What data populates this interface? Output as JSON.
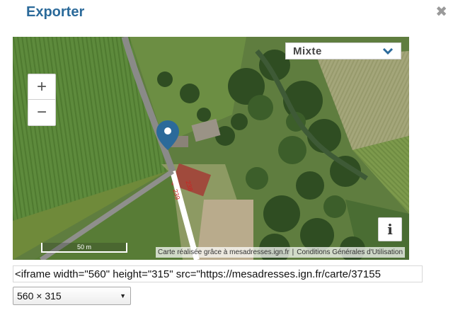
{
  "dialog": {
    "title": "Exporter",
    "close_icon": "close-icon",
    "close_glyph": "✖"
  },
  "map": {
    "zoom_in": "+",
    "zoom_out": "−",
    "layer_selected": "Mixte",
    "info_label": "i",
    "scale_label": "50 m",
    "road_labels": [
      "239",
      "238"
    ],
    "attribution": {
      "credit": "Carte réalisée grâce à mesadresses.ign.fr",
      "separator": "|",
      "terms": "Conditions Générales d'Utilisation"
    },
    "marker_color": "#2b6a9a"
  },
  "embed": {
    "code": "<iframe width=\"560\" height=\"315\" src=\"https://mesadresses.ign.fr/carte/37155"
  },
  "size": {
    "selected": "560 × 315"
  },
  "colors": {
    "title": "#2b6a9a",
    "close": "#9a9a9a"
  }
}
